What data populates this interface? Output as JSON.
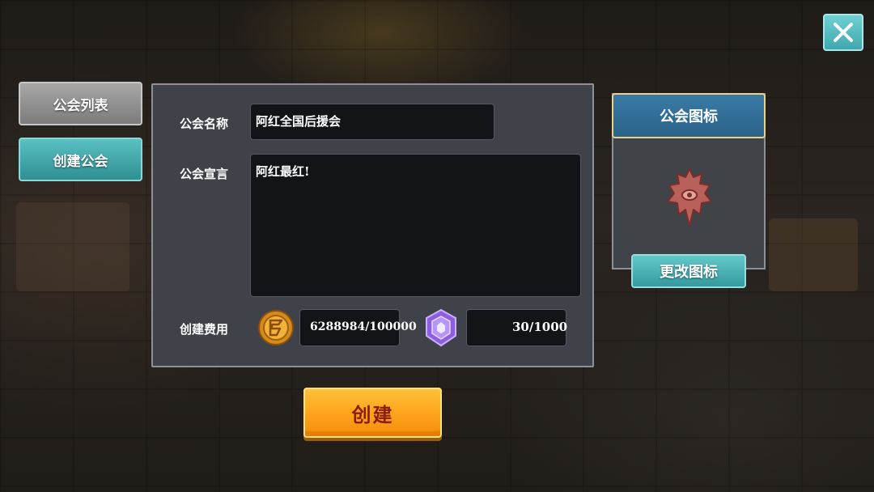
{
  "close_button": {
    "icon": "close-icon"
  },
  "sidebar": {
    "tabs": [
      {
        "label": "公会列表"
      },
      {
        "label": "创建公会"
      }
    ]
  },
  "form": {
    "name_label": "公会名称",
    "name_value": "阿红全国后援会",
    "declaration_label": "公会宣言",
    "declaration_value": "阿红最红!",
    "cost_label": "创建费用",
    "gold_cost": "6288984/100000",
    "gem_cost": "30/1000",
    "gold_icon": "gold-coin-icon",
    "gem_icon": "purple-gem-icon"
  },
  "emblem": {
    "header": "公会图标",
    "icon": "guild-emblem-icon",
    "change_label": "更改图标"
  },
  "create_button": {
    "label": "创建"
  },
  "colors": {
    "accent_teal": "#3fa8ae",
    "accent_orange": "#ffa21a",
    "header_blue": "#2b6288",
    "create_text": "#8b1c10"
  }
}
